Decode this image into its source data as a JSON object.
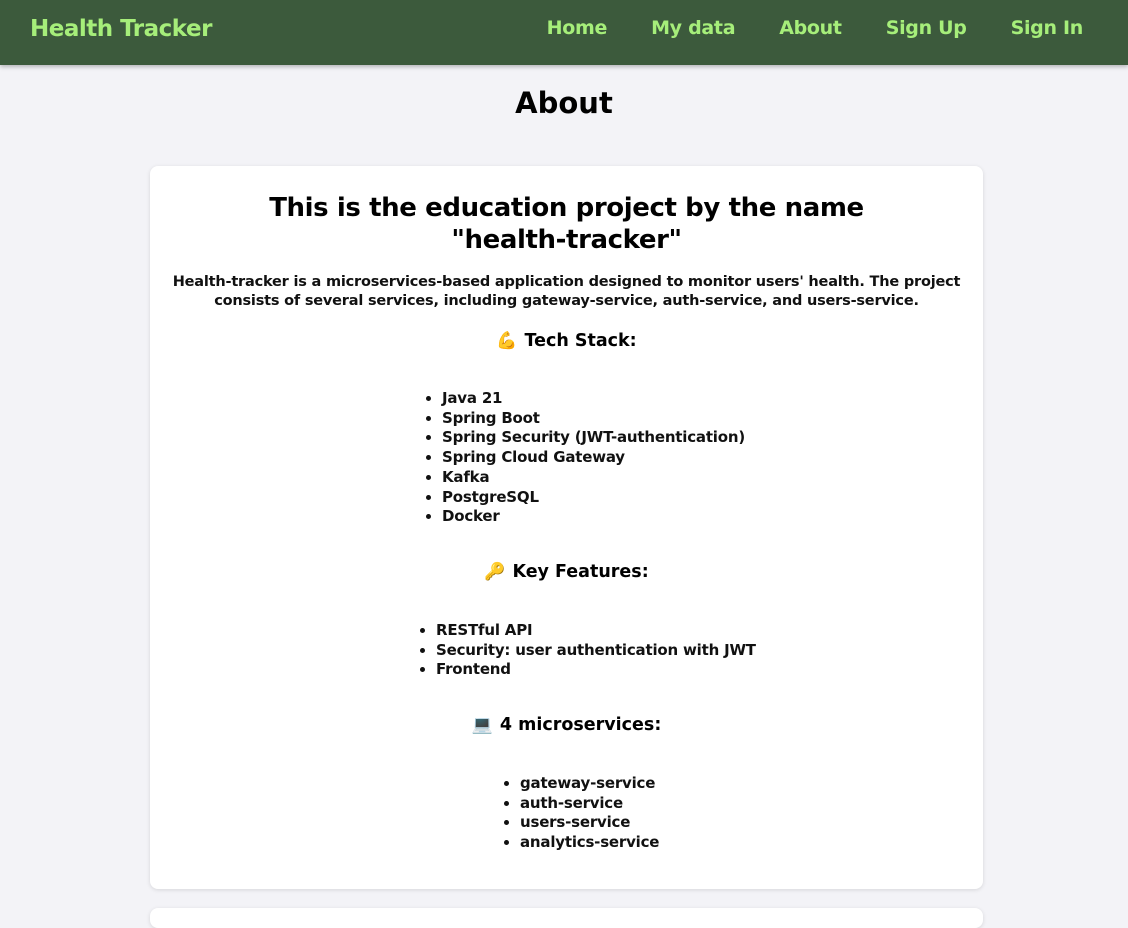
{
  "nav": {
    "brand": "Health Tracker",
    "links": [
      "Home",
      "My data",
      "About",
      "Sign Up",
      "Sign In"
    ]
  },
  "page": {
    "title": "About"
  },
  "card": {
    "title": "This is the education project by the name \"health-tracker\"",
    "description": "Health-tracker is a microservices-based application designed to monitor users' health. The project consists of several services, including gateway-service, auth-service, and users-service.",
    "sections": [
      {
        "icon": "💪",
        "icon_name": "flexed-biceps-icon",
        "heading": "Tech Stack:",
        "items": [
          "Java 21",
          "Spring Boot",
          "Spring Security (JWT-authentication)",
          "Spring Cloud Gateway",
          "Kafka",
          "PostgreSQL",
          "Docker"
        ]
      },
      {
        "icon": "🔑",
        "icon_name": "key-icon",
        "heading": "Key Features:",
        "items": [
          "RESTful API",
          "Security: user authentication with JWT",
          "Frontend"
        ]
      },
      {
        "icon": "💻",
        "icon_name": "laptop-icon",
        "heading": "4 microservices:",
        "items": [
          "gateway-service",
          "auth-service",
          "users-service",
          "analytics-service"
        ]
      }
    ]
  },
  "colors": {
    "navbar_bg": "#3c5a3c",
    "nav_text": "#a6ee7a",
    "page_bg": "#f3f3f7",
    "card_bg": "#ffffff"
  }
}
